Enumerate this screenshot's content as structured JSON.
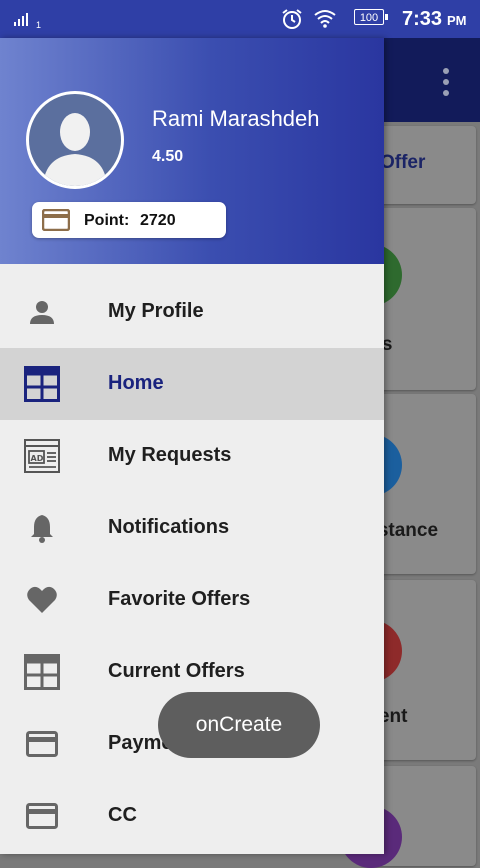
{
  "status_bar": {
    "signal_sub": "1",
    "battery": "100",
    "time": "7:33",
    "ampm": "PM"
  },
  "background_app": {
    "cards": [
      {
        "label": "Offer"
      },
      {
        "label": "nts",
        "circle_color": "#2e7d32"
      },
      {
        "label": "sistance",
        "circle_color": "#1976d2"
      },
      {
        "label": "ment",
        "circle_color": "#c62828"
      },
      {
        "label": "",
        "circle_color": "#6a1b9a"
      }
    ]
  },
  "drawer": {
    "user_name": "Rami Marashdeh",
    "rating": "4.50",
    "points_label": "Point:",
    "points_value": "2720",
    "items": [
      {
        "label": "My Profile",
        "icon": "person-icon"
      },
      {
        "label": "Home",
        "icon": "grid-icon",
        "active": true
      },
      {
        "label": "My Requests",
        "icon": "ad-icon"
      },
      {
        "label": "Notifications",
        "icon": "bell-icon"
      },
      {
        "label": "Favorite Offers",
        "icon": "heart-icon"
      },
      {
        "label": "Current Offers",
        "icon": "grid-icon"
      },
      {
        "label": "Payment",
        "icon": "card-icon"
      },
      {
        "label": "CC",
        "icon": "card-icon"
      }
    ]
  },
  "toast": "onCreate",
  "colors": {
    "status_bar": "#2f3fa6",
    "header_gradient_start": "#6f83cf",
    "header_gradient_end": "#2a36a0",
    "active_item_bg": "#d3d3d3",
    "active_label": "#1a237e"
  }
}
